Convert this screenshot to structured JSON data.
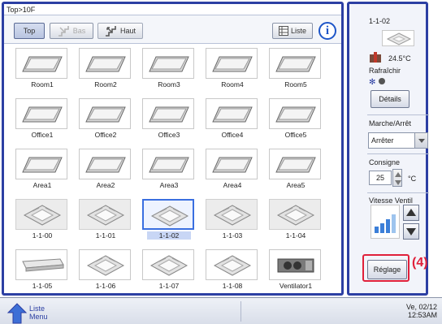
{
  "main": {
    "breadcrumb": "Top>10F",
    "toolbar": {
      "top_label": "Top",
      "bas_label": "Bas",
      "haut_label": "Haut",
      "liste_label": "Liste"
    },
    "rows": [
      {
        "type": "ceiling",
        "items": [
          "Room1",
          "Room2",
          "Room3",
          "Room4",
          "Room5"
        ]
      },
      {
        "type": "ceiling",
        "items": [
          "Office1",
          "Office2",
          "Office3",
          "Office4",
          "Office5"
        ]
      },
      {
        "type": "ceiling",
        "items": [
          "Area1",
          "Area2",
          "Area3",
          "Area4",
          "Area5"
        ]
      },
      {
        "type": "cassette",
        "items": [
          "1-1-00",
          "1-1-01",
          "1-1-02",
          "1-1-03",
          "1-1-04"
        ]
      },
      {
        "type": "mixed",
        "items": [
          "1-1-05",
          "1-1-06",
          "1-1-07",
          "1-1-08",
          "Ventilator1"
        ]
      }
    ],
    "selected_item": "1-1-02"
  },
  "side": {
    "unit_name": "1-1-02",
    "temperature": "24.5°C",
    "mode": "Rafraîchir",
    "details_label": "Détails",
    "power_label": "Marche/Arrêt",
    "power_value": "Arrêter",
    "setpoint_label": "Consigne",
    "setpoint_value": "25",
    "setpoint_unit": "°C",
    "fan_label": "Vitesse Ventil",
    "reglage_label": "Réglage",
    "callout": "(4)"
  },
  "bottom": {
    "menu_line1": "Liste",
    "menu_line2": "Menu",
    "date": "Ve, 02/12",
    "time": "12:53AM"
  },
  "colors": {
    "frame": "#2c3fa3",
    "highlight": "#e0203a",
    "selected": "#3a6fe0"
  }
}
